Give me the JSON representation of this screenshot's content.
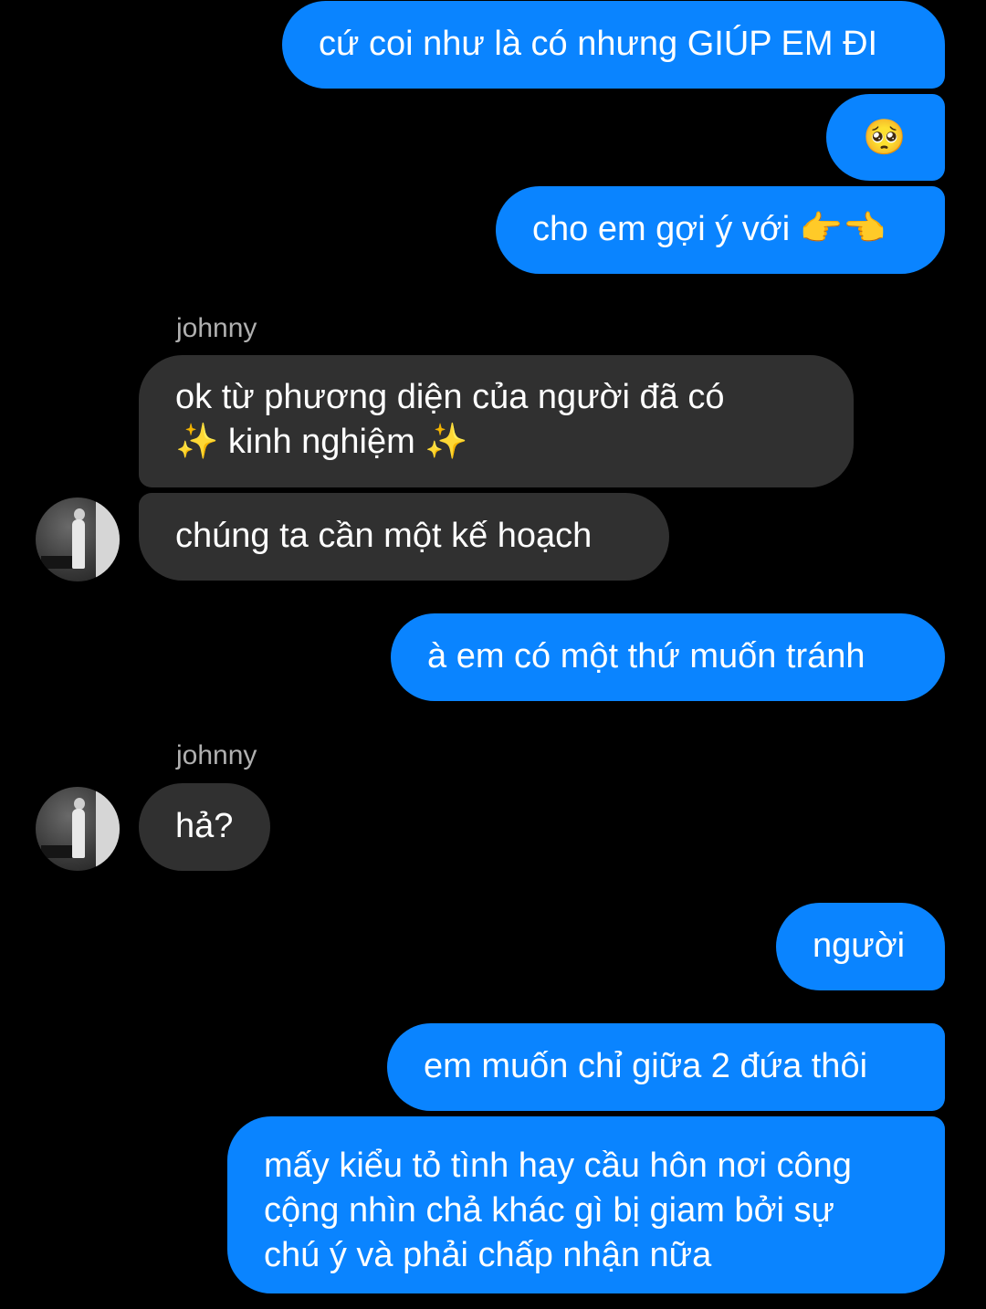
{
  "conversation": {
    "contact_name": "johnny",
    "messages": [
      {
        "id": "m1",
        "direction": "outgoing",
        "text": "cứ coi như là có nhưng GIÚP EM ĐI"
      },
      {
        "id": "m2",
        "direction": "outgoing",
        "text": "🥺"
      },
      {
        "id": "m3",
        "direction": "outgoing",
        "text": "cho em gợi ý với 👉👈"
      },
      {
        "id": "m4",
        "direction": "incoming",
        "sender": "johnny",
        "text_line1": "ok từ phương diện của người đã có",
        "text_line2": "✨ kinh nghiệm ✨"
      },
      {
        "id": "m5",
        "direction": "incoming",
        "text": "chúng ta cần một kế hoạch"
      },
      {
        "id": "m6",
        "direction": "outgoing",
        "text": "à em có một thứ muốn tránh"
      },
      {
        "id": "m7",
        "direction": "incoming",
        "sender": "johnny",
        "text": "hả?"
      },
      {
        "id": "m8",
        "direction": "outgoing",
        "text": "người"
      },
      {
        "id": "m9",
        "direction": "outgoing",
        "text": "em muốn chỉ giữa 2 đứa thôi"
      },
      {
        "id": "m10",
        "direction": "outgoing",
        "text_line1": "mấy kiểu tỏ tình hay cầu hôn nơi công",
        "text_line2": "cộng nhìn chả khác gì bị giam bởi sự",
        "text_line3": "chú ý và phải chấp nhận nữa"
      }
    ]
  },
  "colors": {
    "background": "#000000",
    "outgoing_bubble": "#0a84ff",
    "incoming_bubble": "#303030",
    "sender_label": "#b0b0b0",
    "text": "#ffffff"
  },
  "icons": {
    "avatar": "contact-avatar-photo"
  }
}
